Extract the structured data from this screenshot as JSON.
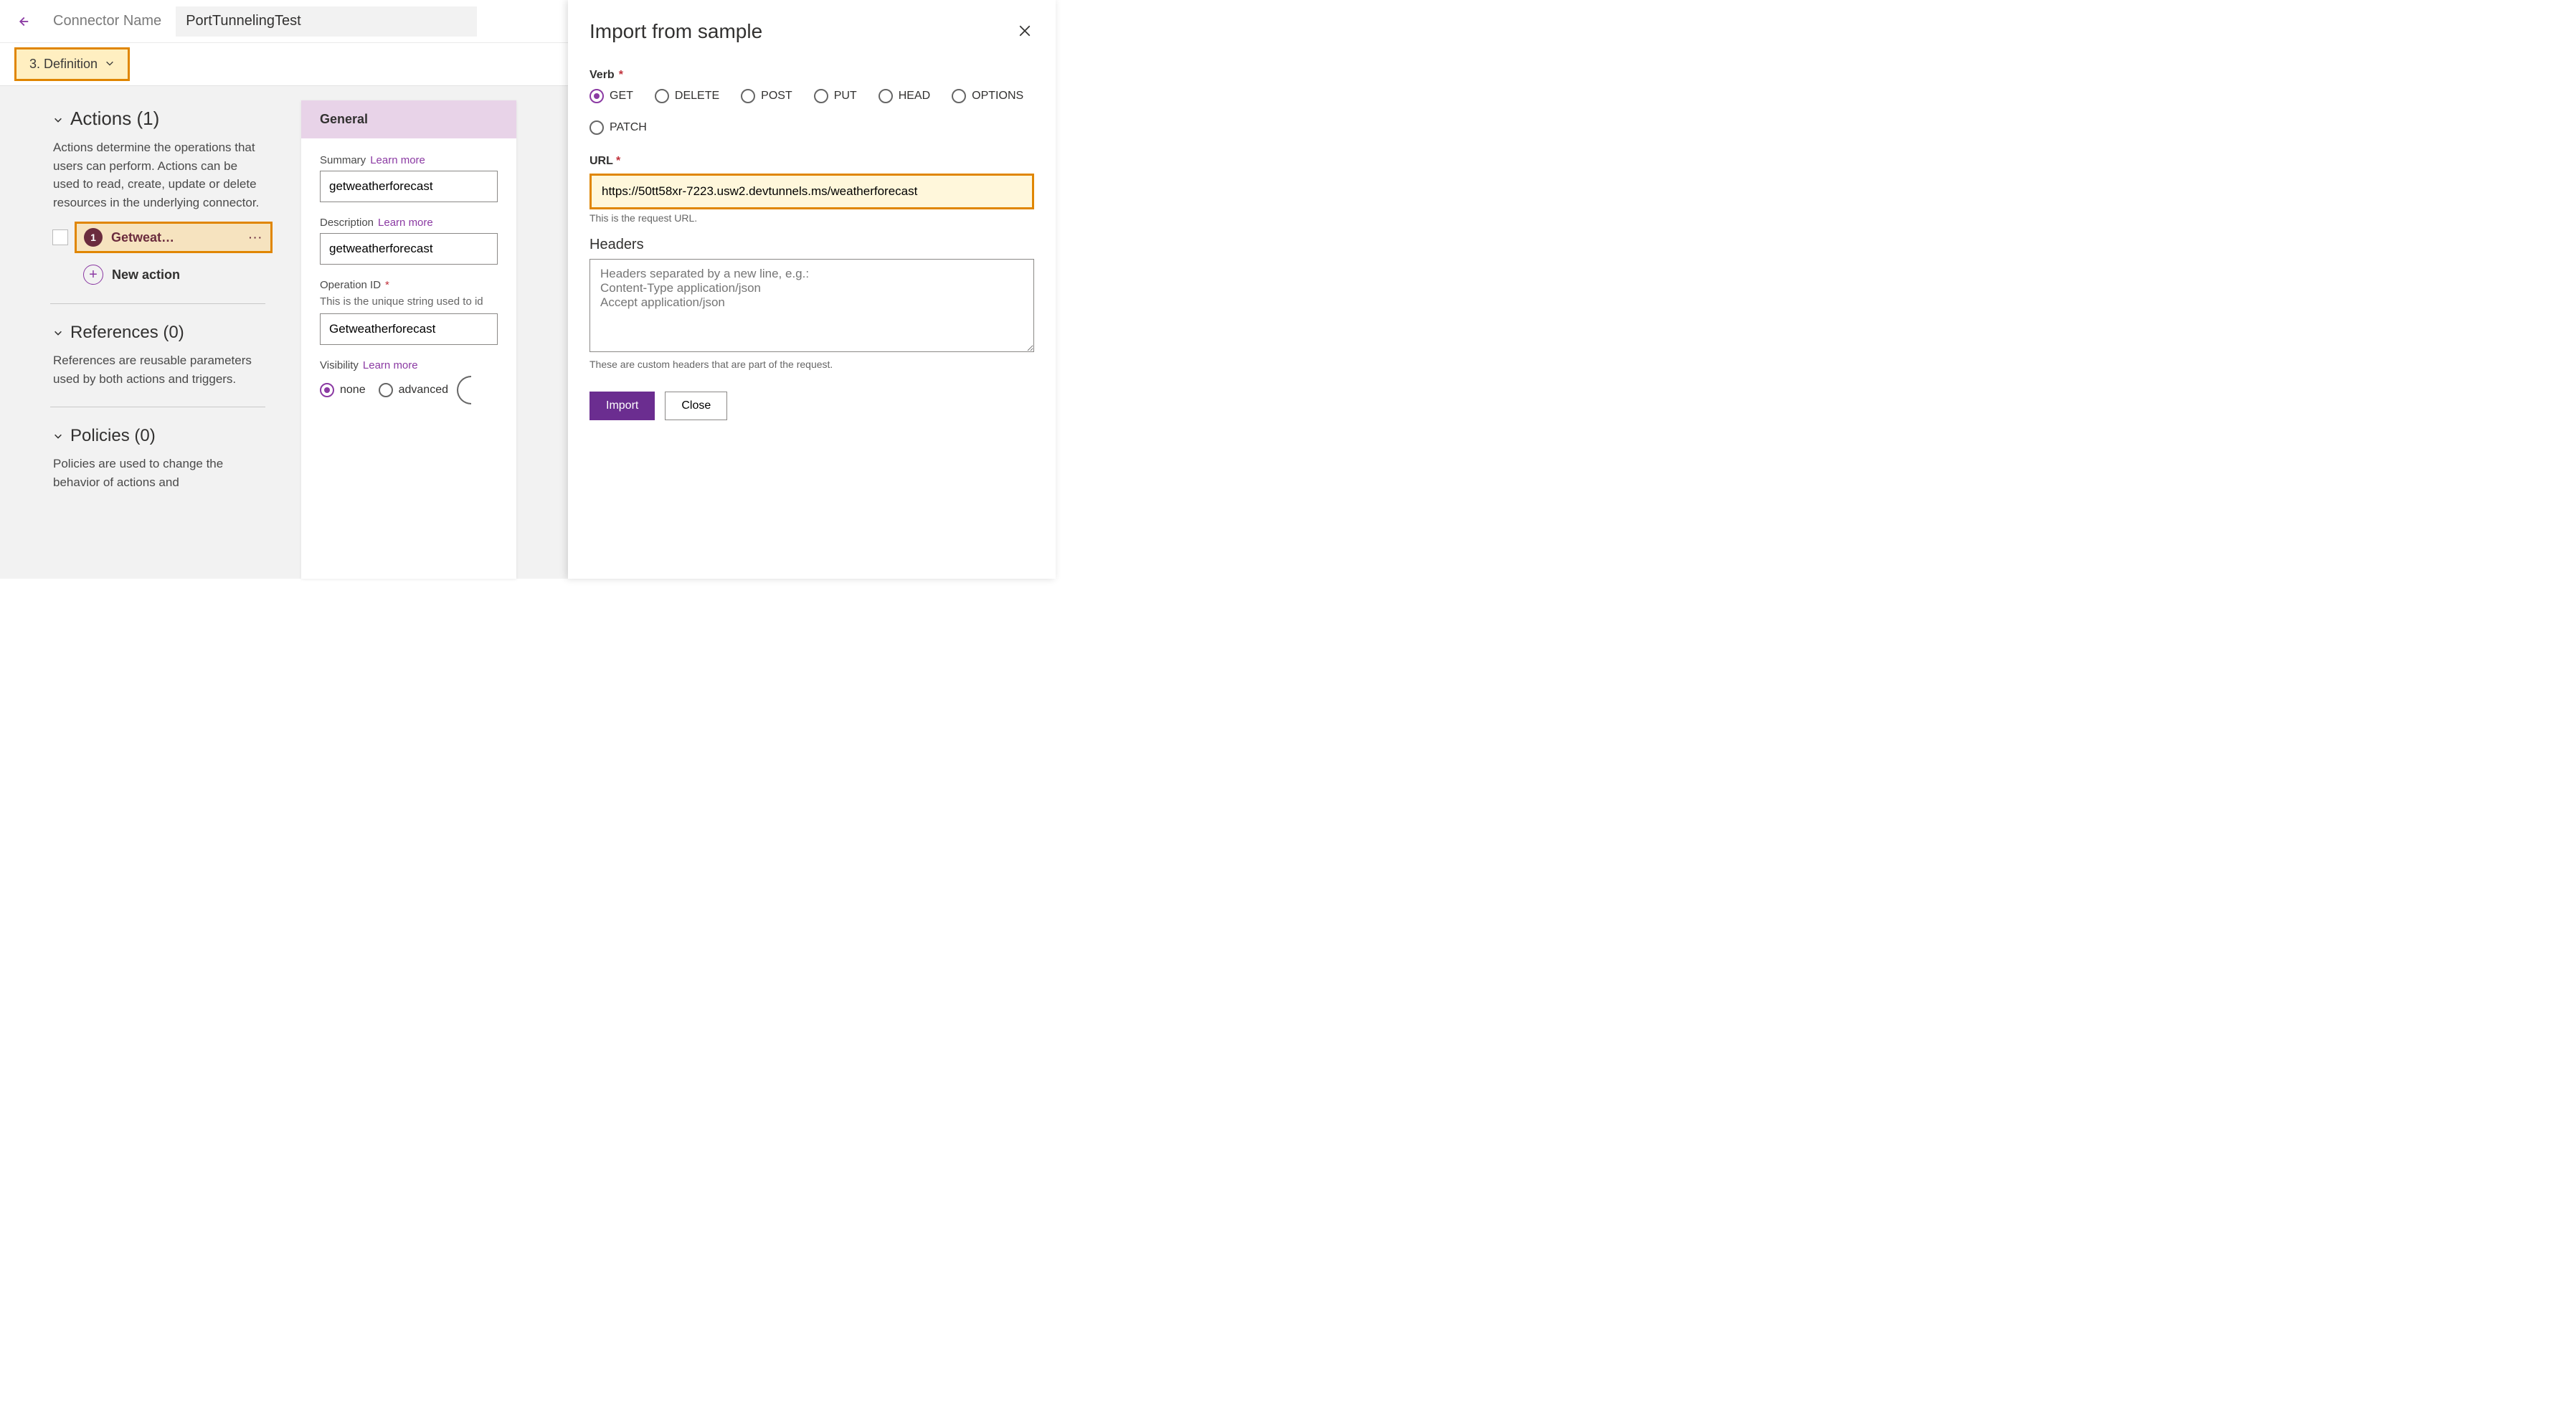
{
  "topbar": {
    "connector_name_label": "Connector Name",
    "connector_name_value": "PortTunnelingTest"
  },
  "stepbar": {
    "step_label": "3. Definition"
  },
  "sidebar": {
    "actions": {
      "title": "Actions (1)",
      "description": "Actions determine the operations that users can perform. Actions can be used to read, create, update or delete resources in the underlying connector.",
      "items": [
        {
          "badge": "1",
          "label": "Getweat…"
        }
      ],
      "new_action_label": "New action"
    },
    "references": {
      "title": "References (0)",
      "description": "References are reusable parameters used by both actions and triggers."
    },
    "policies": {
      "title": "Policies (0)",
      "description": "Policies are used to change the behavior of actions and"
    }
  },
  "card": {
    "header": "General",
    "summary": {
      "label": "Summary",
      "learn": "Learn more",
      "value": "getweatherforecast"
    },
    "description": {
      "label": "Description",
      "learn": "Learn more",
      "value": "getweatherforecast"
    },
    "operation_id": {
      "label": "Operation ID",
      "helper": "This is the unique string used to id",
      "value": "Getweatherforecast"
    },
    "visibility": {
      "label": "Visibility",
      "learn": "Learn more",
      "options": [
        "none",
        "advanced"
      ],
      "selected": "none"
    }
  },
  "panel": {
    "title": "Import from sample",
    "verb": {
      "label": "Verb",
      "options": [
        "GET",
        "DELETE",
        "POST",
        "PUT",
        "HEAD",
        "OPTIONS",
        "PATCH"
      ],
      "selected": "GET"
    },
    "url": {
      "label": "URL",
      "value": "https://50tt58xr-7223.usw2.devtunnels.ms/weatherforecast",
      "hint": "This is the request URL."
    },
    "headers": {
      "label": "Headers",
      "placeholder": "Headers separated by a new line, e.g.:\nContent-Type application/json\nAccept application/json",
      "hint": "These are custom headers that are part of the request."
    },
    "buttons": {
      "import": "Import",
      "close": "Close"
    }
  }
}
